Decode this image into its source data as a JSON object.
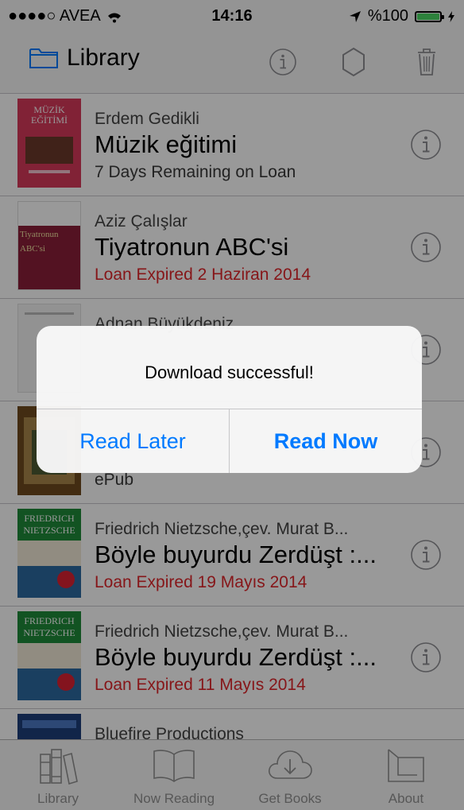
{
  "status_bar": {
    "carrier": "●●●●○ AVEA",
    "time": "14:16",
    "battery": "%100"
  },
  "navbar": {
    "title": "Library",
    "icons": [
      "folder-icon",
      "info-icon",
      "settings-icon",
      "trash-icon"
    ]
  },
  "books": [
    {
      "author": "Erdem Gedikli",
      "title": "Müzik eğitimi",
      "status": "7 Days Remaining on Loan",
      "status_color": "#3a3a3a",
      "cover_text": "MÜZİK EĞİTİMİ"
    },
    {
      "author": "Aziz Çalışlar",
      "title": "Tiyatronun ABC'si",
      "status": "Loan Expired 2 Haziran 2014",
      "status_color": "#e0262b",
      "cover_text": "Tiyatronun ABC'si"
    },
    {
      "author": "Adnan Büyükdeniz",
      "title": "",
      "status": "",
      "status_color": "#3a3a3a",
      "cover_text": ""
    },
    {
      "author": "",
      "title": "",
      "status": "ePub",
      "status_color": "#3a3a3a",
      "cover_text": ""
    },
    {
      "author": "Friedrich Nietzsche,çev. Murat B...",
      "title": "Böyle buyurdu Zerdüşt :...",
      "status": "Loan Expired 19 Mayıs 2014",
      "status_color": "#e0262b",
      "cover_text": "FRIEDRICH NIETZSCHE"
    },
    {
      "author": "Friedrich Nietzsche,çev. Murat B...",
      "title": "Böyle buyurdu Zerdüşt :...",
      "status": "Loan Expired 11 Mayıs 2014",
      "status_color": "#e0262b",
      "cover_text": "FRIEDRICH NIETZSCHE"
    },
    {
      "author": "Bluefire Productions",
      "title": "",
      "status": "",
      "status_color": "#3a3a3a",
      "cover_text": ""
    }
  ],
  "tabs": [
    {
      "label": "Library",
      "icon": "library-icon"
    },
    {
      "label": "Now Reading",
      "icon": "open-book-icon"
    },
    {
      "label": "Get Books",
      "icon": "cloud-download-icon"
    },
    {
      "label": "About",
      "icon": "about-icon"
    }
  ],
  "alert": {
    "message": "Download successful!",
    "secondary_button": "Read Later",
    "primary_button": "Read Now"
  },
  "colors": {
    "accent": "#007aff",
    "expired": "#e0262b",
    "tab_inactive": "#929292"
  }
}
